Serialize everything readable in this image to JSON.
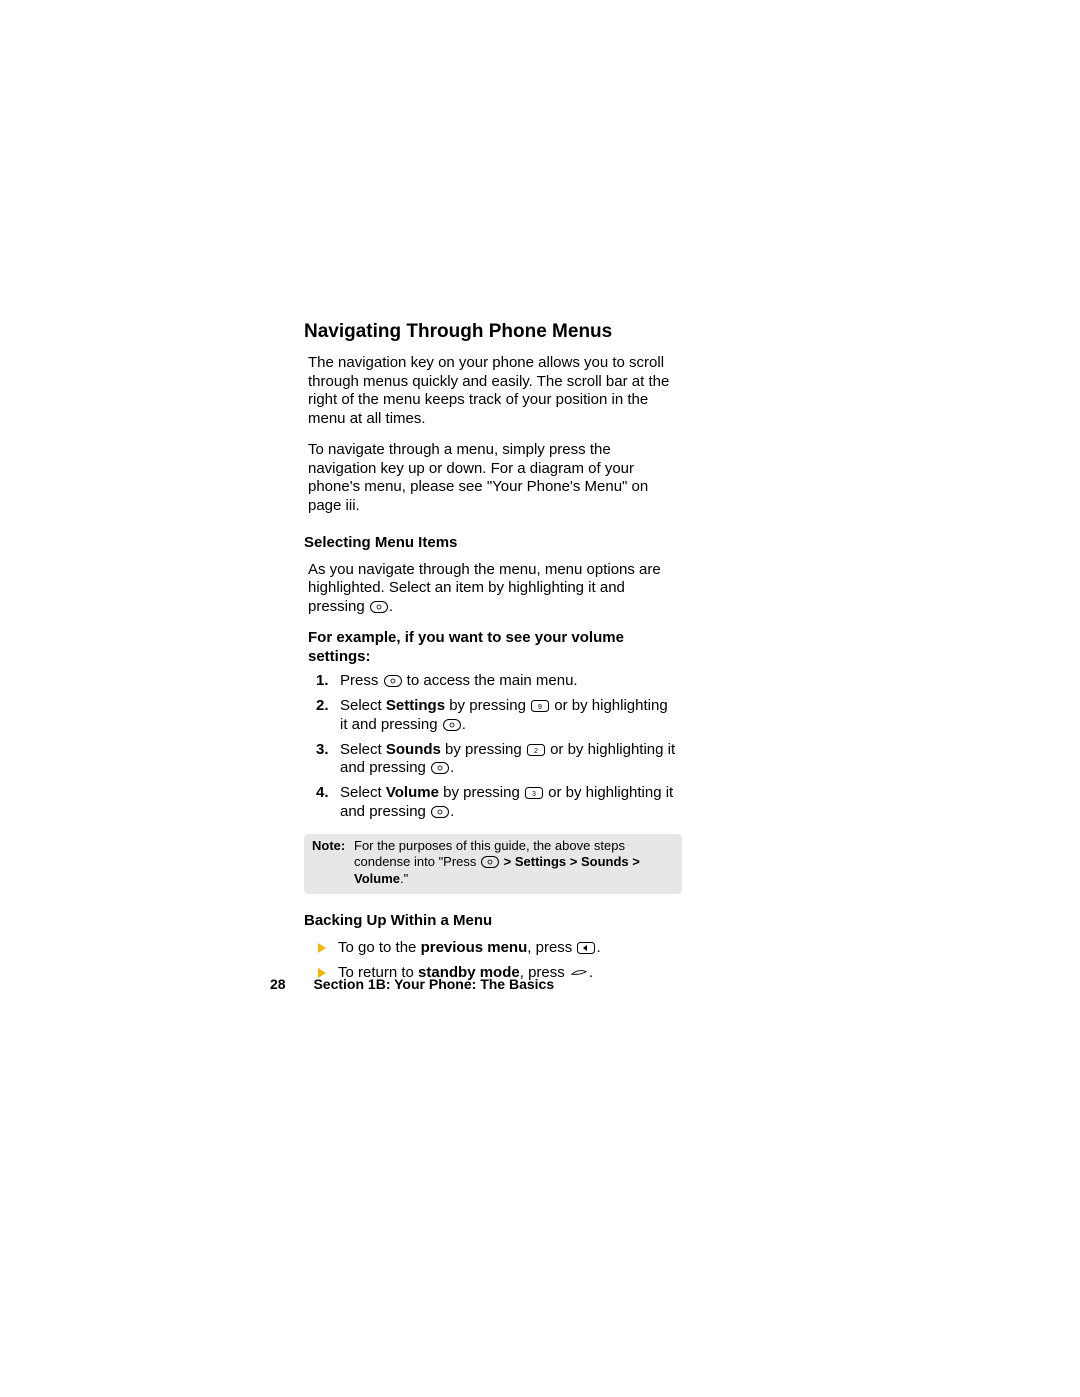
{
  "heading": "Navigating Through Phone Menus",
  "para1": "The navigation key on your phone allows you to scroll through menus quickly and easily. The scroll bar at the right of the menu keeps track of your position in the menu at all times.",
  "para2": "To navigate through a menu, simply press the navigation key up or down. For a diagram of your phone's menu, please see \"Your Phone's Menu\" on page iii.",
  "sub1": "Selecting Menu Items",
  "sub1_para_a": "As you navigate through the menu, menu options are highlighted. Select an item by highlighting it and pressing ",
  "sub1_para_b": ".",
  "example_lead": "For example, if you want to see your volume settings:",
  "steps": {
    "s1": {
      "a": "Press ",
      "b": " to access the main menu."
    },
    "s2": {
      "a": "Select ",
      "bold": "Settings",
      "b": " by pressing ",
      "c": " or by highlighting it and pressing ",
      "d": "."
    },
    "s3": {
      "a": "Select ",
      "bold": "Sounds",
      "b": " by pressing ",
      "c": " or by highlighting it and pressing ",
      "d": "."
    },
    "s4": {
      "a": "Select ",
      "bold": "Volume",
      "b": " by pressing ",
      "c": " or by highlighting it and pressing ",
      "d": "."
    }
  },
  "note": {
    "label": "Note:",
    "a": "For the purposes of this guide, the above steps condense into \"Press ",
    "b": " ",
    "bold": "> Settings > Sounds > Volume",
    "c": ".\""
  },
  "sub2": "Backing Up Within a Menu",
  "bullets": {
    "b1": {
      "a": "To go to the ",
      "bold": "previous menu",
      "b": ", press ",
      "c": "."
    },
    "b2": {
      "a": "To return to ",
      "bold": "standby mode",
      "b": ", press ",
      "c": "."
    }
  },
  "footer": {
    "page": "28",
    "section": "Section 1B: Your Phone: The Basics"
  },
  "icons": {
    "menu": "menu-key-icon",
    "num9": "key-9-icon",
    "num2": "key-2-icon",
    "num3": "key-3-icon",
    "back": "back-key-icon",
    "end": "end-key-icon"
  }
}
